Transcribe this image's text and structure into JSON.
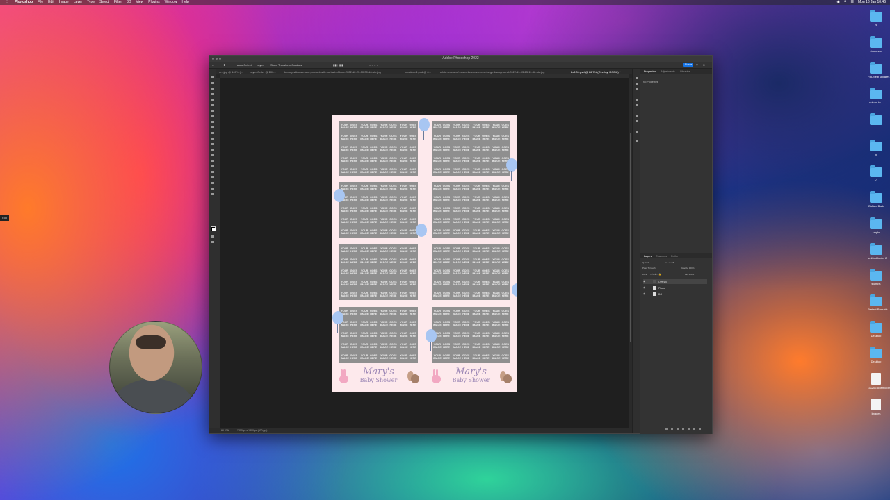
{
  "menubar": {
    "app": "Photoshop",
    "items": [
      "File",
      "Edit",
      "Image",
      "Layer",
      "Type",
      "Select",
      "Filter",
      "3D",
      "View",
      "Plugins",
      "Window",
      "Help"
    ],
    "clock": "Mon 16 Jan 10:46"
  },
  "window": {
    "title": "Adobe Photoshop 2022",
    "options": {
      "auto_select": "Auto-Select:",
      "auto_select_value": "Layer",
      "show_transform": "Show Transform Controls",
      "share_label": "Share"
    },
    "tabs": [
      "nrx.jpg @ 100% (...",
      "Layer Order @ 100...",
      "beauty-skincare-and-product-with-portrait-of-blac-2022-12-23-00-30-16-utc.jpg",
      "mockup-1.psd @ 6...",
      "white-smear-of-cosmetic-cream-on-a-beige-background-2022-11-03-23-11-36-utc.jpg",
      "2x6 04.psd @ 66.7% (Overlay, RGB/8) *"
    ],
    "active_tab_index": 5,
    "status_zoom": "66.67%",
    "status_doc": "1200 px x 1800 px (300 ppi)"
  },
  "properties_panel": {
    "tabs": [
      "Properties",
      "Adjustments",
      "Libraries"
    ],
    "empty_text": "No Properties"
  },
  "layers_panel": {
    "tabs": [
      "Layers",
      "Channels",
      "Paths"
    ],
    "kind": "Q Kind",
    "blend": "Pass Through",
    "opacity": "Opacity: 100%",
    "lock": "Lock:",
    "fill": "Fill: 100%",
    "layers": [
      {
        "name": "Overlay",
        "selected": true
      },
      {
        "name": "Photo",
        "selected": false
      },
      {
        "name": "BG",
        "selected": false
      }
    ]
  },
  "document": {
    "placeholder_line1": "YOUR IMAGE",
    "placeholder_line2": "GOES HERE",
    "footer_title": "Mary's",
    "footer_subtitle": "Baby Shower"
  },
  "desktop_icons": [
    "hr",
    "Jeunesse",
    "FBDSelb updates",
    "upload to...",
    "",
    "bg",
    "v2",
    "Buffalo Bark",
    "smpls",
    "untitled folder 2",
    "thumbs",
    "Perfect Portraits",
    "Desktop",
    "Desktop",
    "GA2023cosmic.xls",
    "Images"
  ],
  "webcam_badge": "0:00",
  "colors": {
    "selection_blue": "#1473e6",
    "folder_blue": "#5bb7f0",
    "canvas_pink": "#fde9ec",
    "footer_text": "#9b86b5"
  }
}
